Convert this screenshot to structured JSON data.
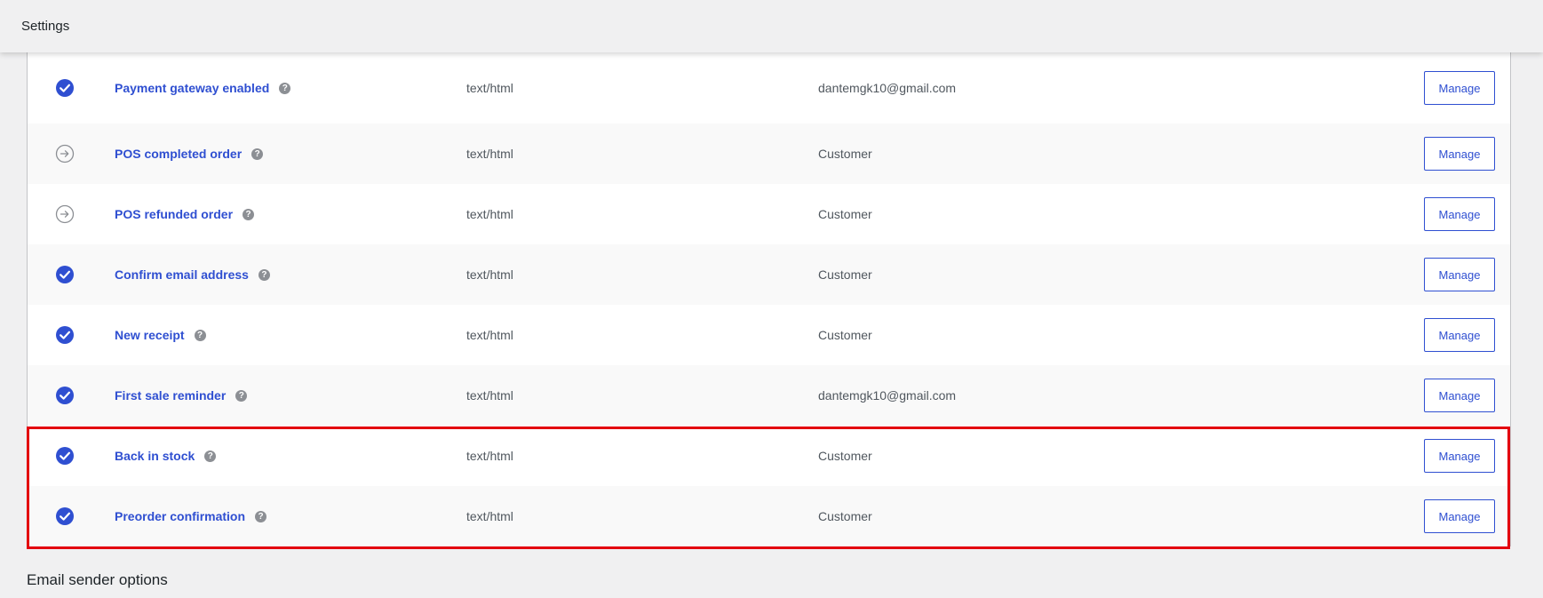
{
  "header": {
    "title": "Settings"
  },
  "emails": [
    {
      "name": "Payment gateway enabled",
      "enabled": true,
      "content_type": "text/html",
      "recipient": "dantemgk10@gmail.com",
      "action": "Manage",
      "status_icon": "check-circle-icon"
    },
    {
      "name": "POS completed order",
      "enabled": false,
      "content_type": "text/html",
      "recipient": "Customer",
      "action": "Manage",
      "status_icon": "arrow-circle-icon"
    },
    {
      "name": "POS refunded order",
      "enabled": false,
      "content_type": "text/html",
      "recipient": "Customer",
      "action": "Manage",
      "status_icon": "arrow-circle-icon"
    },
    {
      "name": "Confirm email address",
      "enabled": true,
      "content_type": "text/html",
      "recipient": "Customer",
      "action": "Manage",
      "status_icon": "check-circle-icon"
    },
    {
      "name": "New receipt",
      "enabled": true,
      "content_type": "text/html",
      "recipient": "Customer",
      "action": "Manage",
      "status_icon": "check-circle-icon"
    },
    {
      "name": "First sale reminder",
      "enabled": true,
      "content_type": "text/html",
      "recipient": "dantemgk10@gmail.com",
      "action": "Manage",
      "status_icon": "check-circle-icon"
    },
    {
      "name": "Back in stock",
      "enabled": true,
      "content_type": "text/html",
      "recipient": "Customer",
      "action": "Manage",
      "status_icon": "check-circle-icon"
    },
    {
      "name": "Preorder confirmation",
      "enabled": true,
      "content_type": "text/html",
      "recipient": "Customer",
      "action": "Manage",
      "status_icon": "check-circle-icon"
    }
  ],
  "help_glyph": "?",
  "section_heading": "Email sender options",
  "colors": {
    "accent": "#2f4fd1",
    "highlight_border": "#e3000f",
    "muted_icon": "#8c8f94"
  }
}
